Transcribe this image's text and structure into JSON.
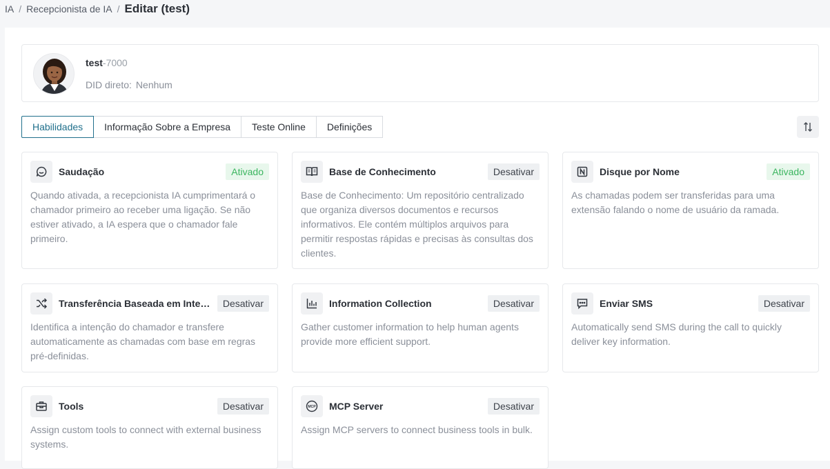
{
  "breadcrumb": {
    "items": [
      "IA",
      "Recepcionista de IA"
    ],
    "current": "Editar (test)"
  },
  "profile": {
    "name": "test",
    "extension": "-7000",
    "did_label": "DID direto:",
    "did_value": "Nenhum"
  },
  "tabs": [
    "Habilidades",
    "Informação Sobre a Empresa",
    "Teste Online",
    "Definições"
  ],
  "sort_icon": "sort-arrows-icon",
  "cards": [
    {
      "title": "Saudação",
      "badge": "Ativado",
      "icon": "chat-bubble-icon",
      "desc": "Quando ativada, a recepcionista IA cumprimentará o chamador primeiro ao receber uma ligação. Se não estiver ativado, a IA espera que o chamador fale primeiro."
    },
    {
      "title": "Base de Conhecimento",
      "badge": "Desativar",
      "icon": "open-book-icon",
      "desc": "Base de Conhecimento: Um repositório centralizado que organiza diversos documentos e recursos informativos. Ele contém múltiplos arquivos para permitir respostas rápidas e precisas às consultas dos clientes."
    },
    {
      "title": "Disque por Nome",
      "badge": "Ativado",
      "icon": "letter-n-icon",
      "desc": "As chamadas podem ser transferidas para uma extensão falando o nome de usuário da ramada."
    },
    {
      "title": "Transferência Baseada em Inte…",
      "badge": "Desativar",
      "icon": "shuffle-icon",
      "desc": "Identifica a intenção do chamador e transfere automaticamente as chamadas com base em regras pré-definidas."
    },
    {
      "title": "Information Collection",
      "badge": "Desativar",
      "icon": "bar-chart-icon",
      "desc": "Gather customer information to help human agents provide more efficient support."
    },
    {
      "title": "Enviar SMS",
      "badge": "Desativar",
      "icon": "message-icon",
      "desc": "Automatically send SMS during the call to quickly deliver key information."
    },
    {
      "title": "Tools",
      "badge": "Desativar",
      "icon": "toolbox-icon",
      "desc": "Assign custom tools to connect with external business systems."
    },
    {
      "title": "MCP Server",
      "badge": "Desativar",
      "icon": "mcp-icon",
      "desc": "Assign MCP servers to connect business tools in bulk."
    }
  ]
}
